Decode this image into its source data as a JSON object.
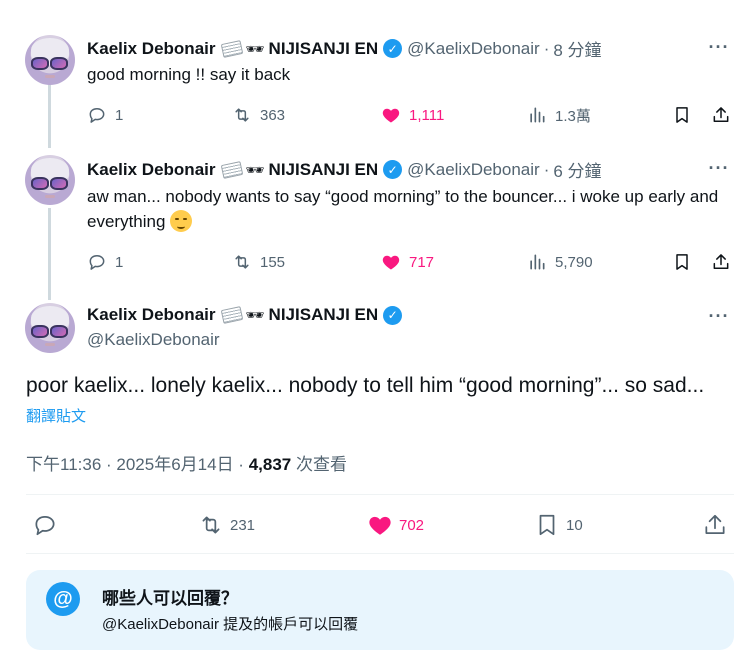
{
  "thread": [
    {
      "display_name": "Kaelix Debonair",
      "team": "NIJISANJI EN",
      "handle": "@KaelixDebonair",
      "separator": "·",
      "time": "8 分鐘",
      "text": "good morning !! say it back",
      "stats": {
        "replies": "1",
        "reposts": "363",
        "likes": "1,111",
        "views": "1.3萬"
      },
      "liked": true
    },
    {
      "display_name": "Kaelix Debonair",
      "team": "NIJISANJI EN",
      "handle": "@KaelixDebonair",
      "separator": "·",
      "time": "6 分鐘",
      "text": "aw man... nobody wants to say “good morning” to the bouncer... i woke up early and everything",
      "stats": {
        "replies": "1",
        "reposts": "155",
        "likes": "717",
        "views": "5,790"
      },
      "liked": true
    }
  ],
  "main_tweet": {
    "display_name": "Kaelix Debonair",
    "team": "NIJISANJI EN",
    "handle": "@KaelixDebonair",
    "text": "poor kaelix... lonely kaelix... nobody to tell him “good morning”... so sad...",
    "translate_label": "翻譯貼文",
    "timestamp": "下午11:36 · 2025年6月14日 ·",
    "views_count": "4,837",
    "views_label": "次查看",
    "stats": {
      "reposts": "231",
      "likes": "702",
      "bookmarks": "10"
    },
    "liked": true
  },
  "reply_settings": {
    "title": "哪些人可以回覆？",
    "subtitle": "@KaelixDebonair 提及的帳戶可以回覆",
    "icon_glyph": "@"
  },
  "icons": {
    "verified": "verified-badge-icon",
    "more": "more-icon",
    "reply": "reply-icon",
    "repost": "repost-icon",
    "like": "heart-icon",
    "views": "views-icon",
    "bookmark": "bookmark-icon",
    "share": "share-icon"
  },
  "colors": {
    "accent": "#1d9bf0",
    "like": "#f91880",
    "muted": "#536471",
    "reply_box_bg": "#e8f5fd"
  }
}
